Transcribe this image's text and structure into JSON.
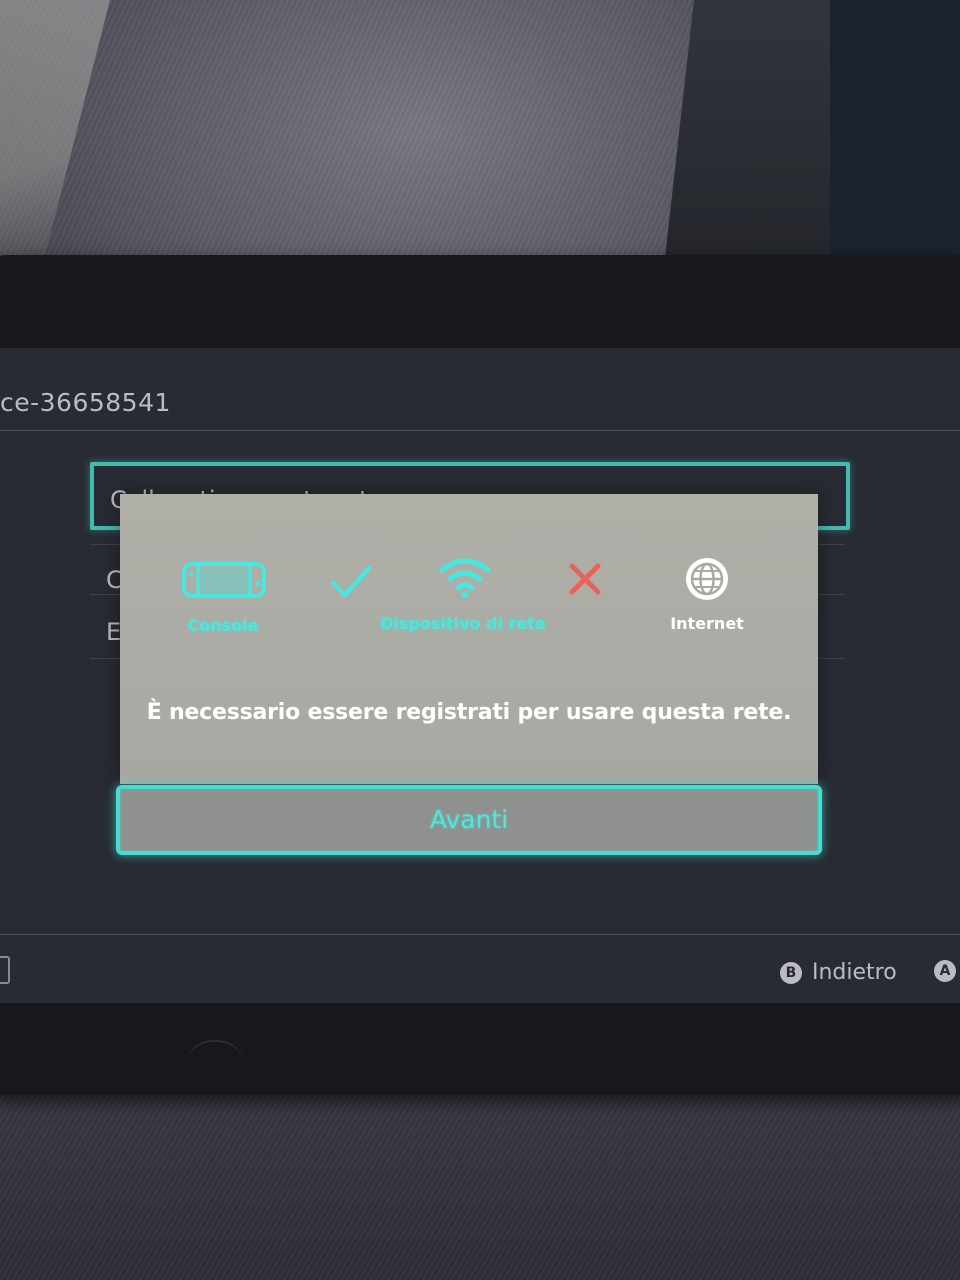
{
  "screen": {
    "network_name": "ce-36658541",
    "menu_items": [
      {
        "label": "Collegati a questa rete"
      },
      {
        "label": "C"
      },
      {
        "label": "El"
      }
    ]
  },
  "dialog": {
    "steps": [
      {
        "icon": "console-icon",
        "label": "Console",
        "state": "ok"
      },
      {
        "icon": "checkmark-icon",
        "label": "",
        "state": "connected"
      },
      {
        "icon": "wifi-icon",
        "label": "Dispositivo di rete",
        "state": "ok"
      },
      {
        "icon": "cross-icon",
        "label": "",
        "state": "failed"
      },
      {
        "icon": "globe-icon",
        "label": "Internet",
        "state": "unreached"
      }
    ],
    "message": "È necessario essere registrati per usare questa rete.",
    "next_button": "Avanti"
  },
  "footer": {
    "back_key": "B",
    "back_label": "Indietro",
    "confirm_key": "A"
  },
  "colors": {
    "accent": "#45e9df",
    "error": "#e8625a",
    "dialog_bg": "#acada6",
    "screen_bg": "#2c3038"
  }
}
